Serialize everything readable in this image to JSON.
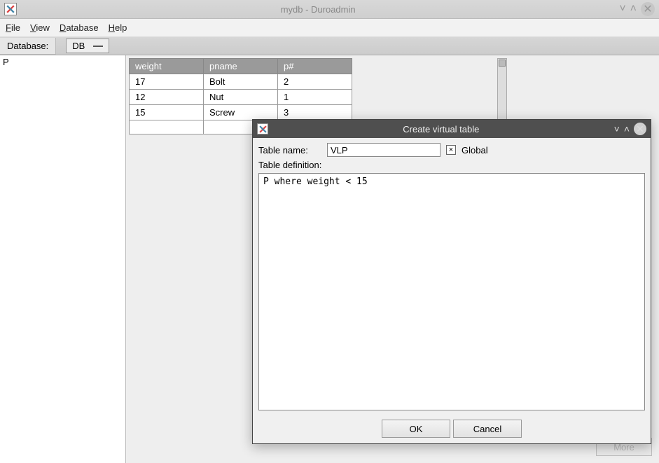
{
  "window": {
    "title": "mydb - Duroadmin"
  },
  "menu": {
    "file": "File",
    "view": "View",
    "database": "Database",
    "help": "Help"
  },
  "toolbar": {
    "database_label": "Database:",
    "database_value": "DB"
  },
  "sidebar": {
    "items": [
      "P"
    ]
  },
  "table": {
    "columns": [
      "weight",
      "pname",
      "p#"
    ],
    "rows": [
      {
        "weight": "17",
        "pname": "Bolt",
        "pnum": "2"
      },
      {
        "weight": "12",
        "pname": "Nut",
        "pnum": "1"
      },
      {
        "weight": "15",
        "pname": "Screw",
        "pnum": "3"
      }
    ]
  },
  "more_button": "More",
  "dialog": {
    "title": "Create virtual table",
    "table_name_label": "Table name:",
    "table_name_value": "VLP",
    "global_label": "Global",
    "global_checked": "×",
    "definition_label": "Table definition:",
    "definition_value": "P where weight < 15",
    "ok": "OK",
    "cancel": "Cancel"
  }
}
